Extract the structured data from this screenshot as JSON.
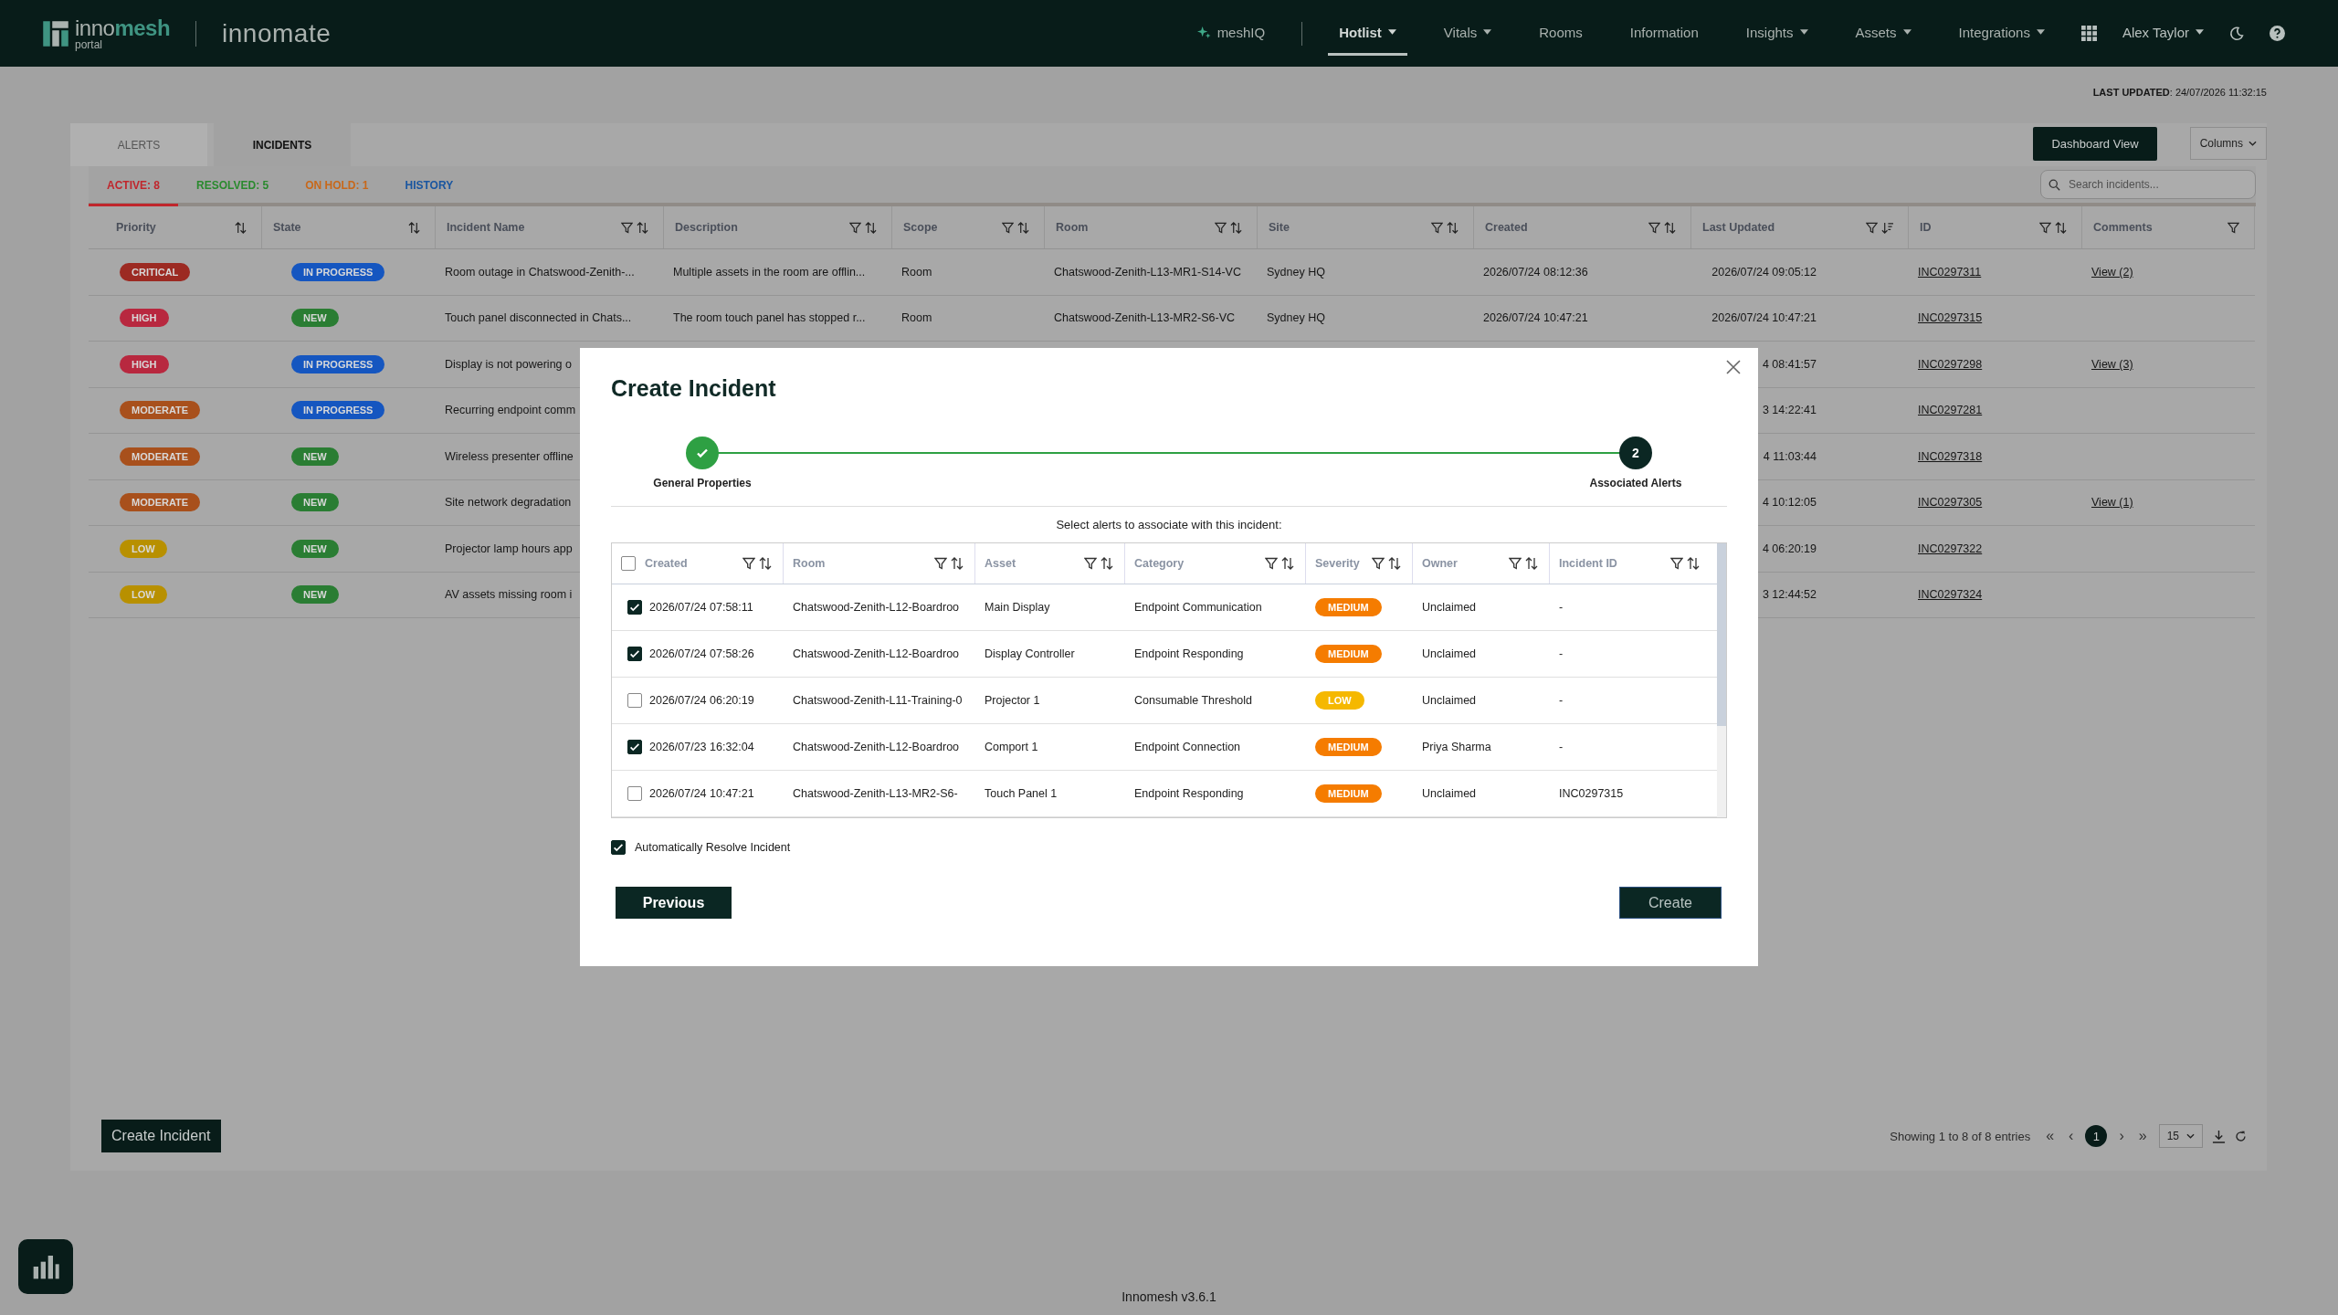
{
  "header": {
    "logo": {
      "word_a": "inno",
      "word_b": "mesh",
      "sub": "portal"
    },
    "app_name": "innomate",
    "nav": [
      {
        "label": "meshIQ",
        "kind": "ai",
        "selected": false,
        "dropdown": false
      },
      {
        "label": "Hotlist",
        "kind": "link",
        "selected": true,
        "dropdown": true
      },
      {
        "label": "Vitals",
        "kind": "link",
        "selected": false,
        "dropdown": true
      },
      {
        "label": "Rooms",
        "kind": "link",
        "selected": false,
        "dropdown": false
      },
      {
        "label": "Information",
        "kind": "link",
        "selected": false,
        "dropdown": false
      },
      {
        "label": "Insights",
        "kind": "link",
        "selected": false,
        "dropdown": true
      },
      {
        "label": "Assets",
        "kind": "link",
        "selected": false,
        "dropdown": true
      },
      {
        "label": "Integrations",
        "kind": "link",
        "selected": false,
        "dropdown": true
      }
    ],
    "user": "Alex Taylor"
  },
  "last_updated": "**LAST UPDATED**: 24/07/2026 11:32:15",
  "tabs": [
    {
      "label": "ALERTS",
      "selected": false
    },
    {
      "label": "INCIDENTS",
      "selected": true
    }
  ],
  "filters": [
    {
      "label": "ACTIVE: 8",
      "color": "#c0262c",
      "selected": true
    },
    {
      "label": "RESOLVED: 5",
      "color": "#2a8a2e",
      "selected": false
    },
    {
      "label": "ON HOLD: 1",
      "color": "#c8681a",
      "selected": false
    },
    {
      "label": "HISTORY",
      "color": "#1a56a0",
      "selected": false
    }
  ],
  "toolbar": {
    "dashboard_button": "Dashboard View",
    "columns_button": "Columns",
    "search": {
      "placeholder": "Search incidents..."
    }
  },
  "table": {
    "columns": [
      {
        "label": "Priority",
        "filter": false,
        "sortable": true,
        "sorted_desc": false
      },
      {
        "label": "State",
        "filter": false,
        "sortable": true,
        "sorted_desc": false
      },
      {
        "label": "Incident Name",
        "filter": true,
        "sortable": true,
        "sorted_desc": false
      },
      {
        "label": "Description",
        "filter": true,
        "sortable": true,
        "sorted_desc": false
      },
      {
        "label": "Scope",
        "filter": true,
        "sortable": true,
        "sorted_desc": false
      },
      {
        "label": "Room",
        "filter": true,
        "sortable": true,
        "sorted_desc": false
      },
      {
        "label": "Site",
        "filter": true,
        "sortable": true,
        "sorted_desc": false
      },
      {
        "label": "Created",
        "filter": true,
        "sortable": true,
        "sorted_desc": false
      },
      {
        "label": "Last Updated",
        "filter": true,
        "sortable": true,
        "sorted_desc": true
      },
      {
        "label": "ID",
        "filter": true,
        "sortable": true,
        "sorted_desc": false
      },
      {
        "label": "Comments",
        "filter": true,
        "sortable": false,
        "sorted_desc": false
      }
    ],
    "rows": [
      {
        "priority": {
          "label": "CRITICAL",
          "color": "#9c2a22"
        },
        "state": {
          "label": "IN PROGRESS",
          "color": "#1556c0"
        },
        "name": "Room outage in Chatswood-Zenith-...",
        "description": "Multiple assets in the room are offlin...",
        "scope": "Room",
        "room": "Chatswood-Zenith-L13-MR1-S14-VC",
        "site": "Sydney HQ",
        "created": "2026/07/24 08:12:36",
        "last_updated": "2026/07/24 09:05:12",
        "id": "INC0297311",
        "comments": "View (2)"
      },
      {
        "priority": {
          "label": "HIGH",
          "color": "#b8283f"
        },
        "state": {
          "label": "NEW",
          "color": "#2a7d33"
        },
        "name": "Touch panel disconnected in Chats...",
        "description": "The room touch panel has stopped r...",
        "scope": "Room",
        "room": "Chatswood-Zenith-L13-MR2-S6-VC",
        "site": "Sydney HQ",
        "created": "2026/07/24 10:47:21",
        "last_updated": "2026/07/24 10:47:21",
        "id": "INC0297315"
      },
      {
        "priority": {
          "label": "HIGH",
          "color": "#b8283f"
        },
        "state": {
          "label": "IN PROGRESS",
          "color": "#1556c0"
        },
        "name": "Display is not powering o",
        "last_updated": "4 08:41:57",
        "id": "INC0297298",
        "comments": "View (3)"
      },
      {
        "priority": {
          "label": "MODERATE",
          "color": "#a8501c"
        },
        "state": {
          "label": "IN PROGRESS",
          "color": "#1556c0"
        },
        "name": "Recurring endpoint comm",
        "last_updated": "3 14:22:41",
        "id": "INC0297281"
      },
      {
        "priority": {
          "label": "MODERATE",
          "color": "#a8501c"
        },
        "state": {
          "label": "NEW",
          "color": "#2a7d33"
        },
        "name": "Wireless presenter offline",
        "last_updated": "4 11:03:44",
        "id": "INC0297318"
      },
      {
        "priority": {
          "label": "MODERATE",
          "color": "#a8501c"
        },
        "state": {
          "label": "NEW",
          "color": "#2a7d33"
        },
        "name": "Site network degradation",
        "last_updated": "4 10:12:05",
        "id": "INC0297305",
        "comments": "View (1)"
      },
      {
        "priority": {
          "label": "LOW",
          "color": "#b89000"
        },
        "state": {
          "label": "NEW",
          "color": "#2a7d33"
        },
        "name": "Projector lamp hours app",
        "last_updated": "4 06:20:19",
        "id": "INC0297322"
      },
      {
        "priority": {
          "label": "LOW",
          "color": "#b89000"
        },
        "state": {
          "label": "NEW",
          "color": "#2a7d33"
        },
        "name": "AV assets missing room i",
        "last_updated": "3 12:44:52",
        "id": "INC0297324"
      }
    ]
  },
  "footer": {
    "create_button": "Create Incident",
    "summary": "Showing 1 to 8 of 8 entries",
    "pager": [
      {
        "label": "«",
        "kind": "nav",
        "selected": false
      },
      {
        "label": "‹",
        "kind": "nav",
        "selected": false
      },
      {
        "label": "1",
        "kind": "page",
        "selected": true
      },
      {
        "label": "›",
        "kind": "nav",
        "selected": false
      },
      {
        "label": "»",
        "kind": "nav",
        "selected": false
      }
    ],
    "page_size": "15"
  },
  "version": "Innomesh v3.6.1",
  "modal": {
    "title": "Create Incident",
    "steps": [
      {
        "label": "General Properties",
        "done": true
      },
      {
        "label": "Associated Alerts",
        "done": false,
        "number": "2"
      }
    ],
    "instruction": "Select alerts to associate with this incident:",
    "select_all": false,
    "columns": [
      {
        "label": "Created"
      },
      {
        "label": "Room"
      },
      {
        "label": "Asset"
      },
      {
        "label": "Category"
      },
      {
        "label": "Severity"
      },
      {
        "label": "Owner"
      },
      {
        "label": "Incident ID"
      }
    ],
    "rows": [
      {
        "checked": true,
        "created": "2026/07/24 07:58:11",
        "room": "Chatswood-Zenith-L12-Boardroo",
        "asset": "Main Display",
        "category": "Endpoint Communication",
        "severity": {
          "label": "MEDIUM",
          "color": "#f57c00"
        },
        "owner": "Unclaimed",
        "incident_id": "-"
      },
      {
        "checked": true,
        "created": "2026/07/24 07:58:26",
        "room": "Chatswood-Zenith-L12-Boardroo",
        "asset": "Display Controller",
        "category": "Endpoint Responding",
        "severity": {
          "label": "MEDIUM",
          "color": "#f57c00"
        },
        "owner": "Unclaimed",
        "incident_id": "-"
      },
      {
        "checked": false,
        "created": "2026/07/24 06:20:19",
        "room": "Chatswood-Zenith-L11-Training-0",
        "asset": "Projector 1",
        "category": "Consumable Threshold",
        "severity": {
          "label": "LOW",
          "color": "#f5b800"
        },
        "owner": "Unclaimed",
        "incident_id": "-"
      },
      {
        "checked": true,
        "created": "2026/07/23 16:32:04",
        "room": "Chatswood-Zenith-L12-Boardroo",
        "asset": "Comport 1",
        "category": "Endpoint Connection",
        "severity": {
          "label": "MEDIUM",
          "color": "#f57c00"
        },
        "owner": "Priya Sharma",
        "incident_id": "-"
      },
      {
        "checked": false,
        "created": "2026/07/24 10:47:21",
        "room": "Chatswood-Zenith-L13-MR2-S6-",
        "asset": "Touch Panel 1",
        "category": "Endpoint Responding",
        "severity": {
          "label": "MEDIUM",
          "color": "#f57c00"
        },
        "owner": "Unclaimed",
        "incident_id": "INC0297315"
      }
    ],
    "auto_resolve": {
      "label": "Automatically Resolve Incident",
      "checked": true
    },
    "previous_button": "Previous",
    "create_button": "Create"
  }
}
